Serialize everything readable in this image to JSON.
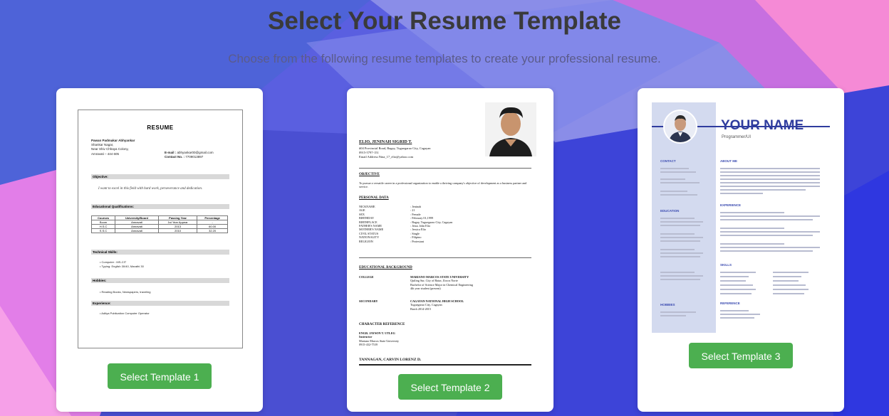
{
  "page": {
    "title": "Select Your Resume Template",
    "subtitle": "Choose from the following resume templates to create your professional resume."
  },
  "colors": {
    "button": "#4caf50",
    "title": "#3a3a3a",
    "bg_blue": "#5a5fe0",
    "bg_pink": "#f06ad8"
  },
  "templates": [
    {
      "button_label": "Select Template 1",
      "preview": {
        "heading": "RESUME",
        "name": "Pawan Padmakar Abhyankar",
        "address": [
          "Shankar Nagar,",
          "Near Shiv Chhaya Colony,",
          "Amravati – 444 605"
        ],
        "email_label": "E-mail :",
        "email": "abhyankar00@gmail.com",
        "contact_label": "Contact No. :",
        "contact": "7709013897",
        "sections": {
          "objective": "Objective:",
          "education": "Educational Qualifications:",
          "skills": "Technical Skills:",
          "hobbies": "Hobbies:",
          "experience": "Experience:"
        },
        "objective_text": "I want to excel in this field with hard work, perseverance and dedication.",
        "table": {
          "headers": [
            "Courses",
            "University/Board",
            "Passing Year",
            "Percentage"
          ],
          "rows": [
            [
              "Bcom",
              "Amravati",
              "1st Year Appear",
              "-"
            ],
            [
              "H.S.C",
              "Amravati",
              "2013",
              "60.00"
            ],
            [
              "S.S.C",
              "Amravati",
              "2010",
              "32.20"
            ]
          ]
        },
        "skills": [
          "Computer : MS-CIT",
          "Typing: English 30/40, Marathi 30"
        ],
        "hobbies": [
          "Reading Books, Newspapers, traveling"
        ],
        "experience": [
          "Aditya Publication Computer Operator"
        ]
      }
    },
    {
      "button_label": "Select Template 2",
      "preview": {
        "name": "ELIO, JENINAH SIGRID T.",
        "address_lines": [
          "#04 Provincial Road, Bagay, Tuguegarao City, Cagayan",
          "0915-5797-151",
          "Email Address:Nina_17_elio@yahoo.com"
        ],
        "objective_heading": "OBJECTIVE",
        "objective_text": "To pursue a versatile career in a professional organization to enable a thriving company's objective of development as a business partner and service.",
        "personal_heading": "PERSONAL DATA",
        "personal": [
          {
            "k": "NICKNAME",
            "v": ": Jeninah"
          },
          {
            "k": "AGE",
            "v": ": 21"
          },
          {
            "k": "SEX",
            "v": ": Female"
          },
          {
            "k": "BIRTHDAY",
            "v": ": February 01,1999"
          },
          {
            "k": "BIRTHPLACE",
            "v": ": Bagay, Tuguegarao City, Cagayan"
          },
          {
            "k": "FATHER'S NAME",
            "v": ": Jesus John Elio"
          },
          {
            "k": "MOTHER'S NAME",
            "v": ": Jessica Elio"
          },
          {
            "k": "CIVIL STATUS",
            "v": ": Single"
          },
          {
            "k": "NATIONALITY",
            "v": ": Filipino"
          },
          {
            "k": "RELIGION",
            "v": ": Protestant"
          }
        ],
        "education_heading": "EDUCATIONAL BACKGROUND",
        "college_label": "COLLEGE",
        "college": [
          "MARIANO MARCOS STATE UNIVERSITY",
          "Quiling Sur, City of Batac, Ilocos Norte",
          "Bachelor of Science Major in Chemical Engineering",
          "4th year student (present)"
        ],
        "secondary_label": "SECONDARY",
        "secondary": [
          "CAGAYAN NATIONAL HIGH SCHOOL",
          "Tuguegarao City, Cagayan",
          "Batch 2014-2015"
        ],
        "reference_heading": "CHARACTER REFERENCE",
        "reference": [
          "ENGR. JAYSON T. UTLEG",
          "Instructor",
          "Mariano Marcos State University",
          "0915-432-7539"
        ],
        "footer_name": "TANNAGAN, CARVIN LORENZ D."
      }
    },
    {
      "button_label": "Select Template 3",
      "preview": {
        "name": "YOUR NAME",
        "role": "Programmer/UI",
        "sections": {
          "contact": "CONTACT",
          "about": "ABOUT ME",
          "education": "EDUCATION",
          "experience": "EXPERIENCE",
          "skills": "SKILLS",
          "hobbies": "HOBBIES",
          "reference": "REFERENCE"
        }
      }
    }
  ]
}
